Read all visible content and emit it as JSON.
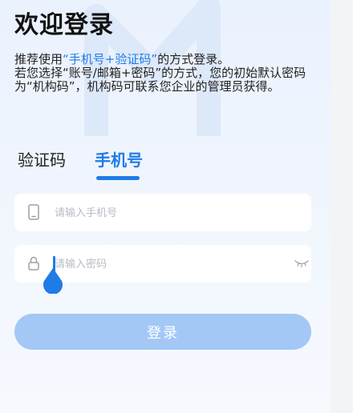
{
  "header": {
    "title": "欢迎登录"
  },
  "description": {
    "line1_prefix": "推荐使用",
    "line1_highlight": "“手机号+验证码”",
    "line1_suffix": "的方式登录。",
    "line2": "若您选择“账号/邮箱+密码”的方式，您的初始默认密码为“机构码”，机构码可联系您企业的管理员获得。"
  },
  "tabs": [
    {
      "label": "验证码",
      "active": false
    },
    {
      "label": "手机号",
      "active": true
    }
  ],
  "form": {
    "phone_placeholder": "请输入手机号",
    "password_placeholder": "请输入密码",
    "login_label": "登录"
  },
  "colors": {
    "accent": "#1f7be7",
    "button_disabled": "#a3c8f6"
  }
}
